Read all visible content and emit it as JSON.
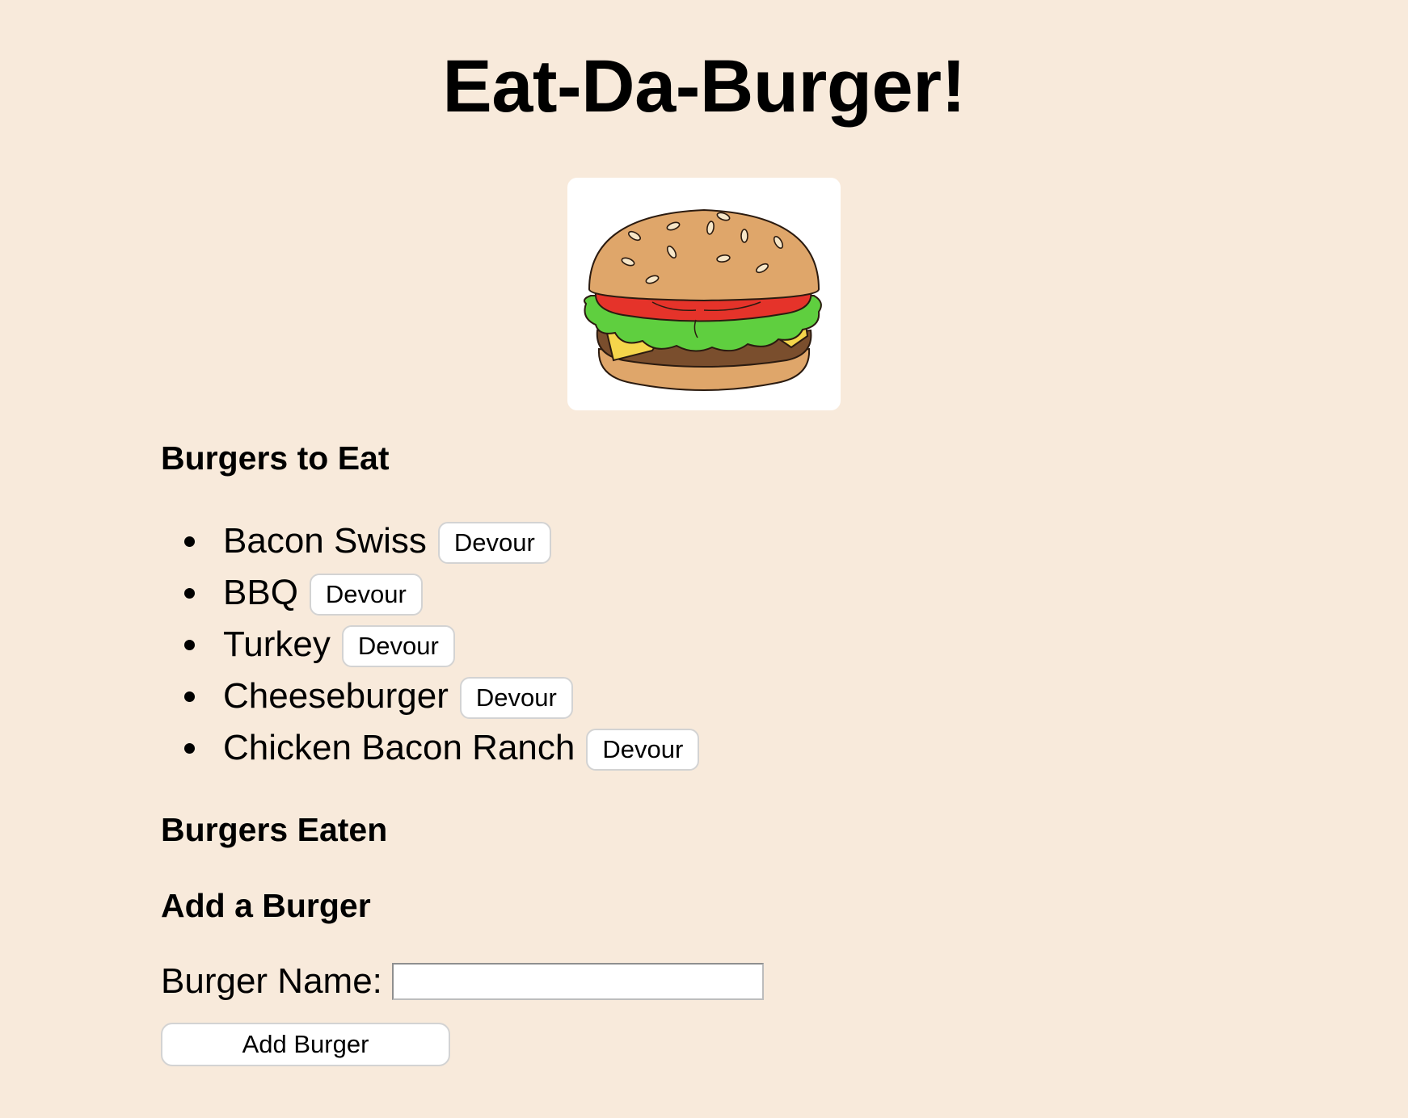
{
  "header": {
    "title": "Eat-Da-Burger!"
  },
  "image": {
    "icon": "burger-illustration",
    "colors": {
      "bun": "#dfa66a",
      "tomato": "#e5332a",
      "lettuce": "#5fcf3f",
      "cheese": "#f5d54b",
      "patty": "#7a4e2d",
      "outline": "#2b1b10"
    }
  },
  "to_eat": {
    "heading": "Burgers to Eat",
    "items": [
      {
        "name": "Bacon Swiss",
        "button": "Devour"
      },
      {
        "name": "BBQ",
        "button": "Devour"
      },
      {
        "name": "Turkey",
        "button": "Devour"
      },
      {
        "name": "Cheeseburger",
        "button": "Devour"
      },
      {
        "name": "Chicken Bacon Ranch",
        "button": "Devour"
      }
    ]
  },
  "eaten": {
    "heading": "Burgers Eaten"
  },
  "add": {
    "heading": "Add a Burger",
    "label": "Burger Name:",
    "input_value": "",
    "button": "Add Burger"
  },
  "theme": {
    "background": "#f8eadb",
    "card": "#ffffff",
    "button_border": "#d3d3d3"
  }
}
